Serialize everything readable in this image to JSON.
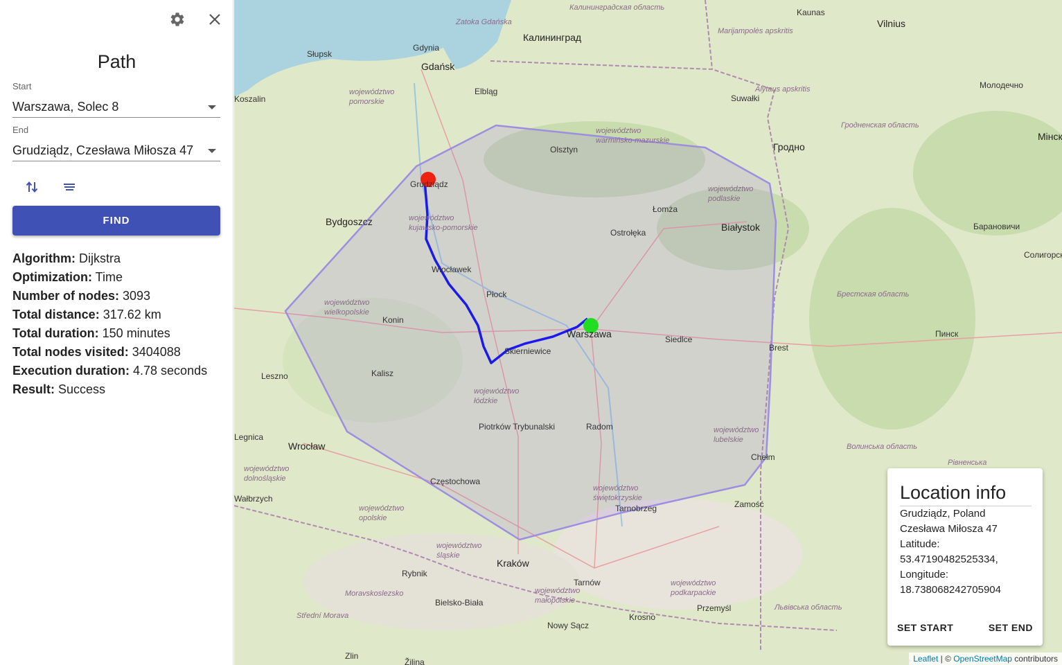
{
  "sidebar": {
    "title": "Path",
    "start_label": "Start",
    "start_value": "Warszawa,  Solec 8",
    "end_label": "End",
    "end_value": "Grudziądz,  Czesława Miłosza 47",
    "find_label": "FIND",
    "results": [
      {
        "label": "Algorithm:",
        "value": "Dijkstra"
      },
      {
        "label": "Optimization:",
        "value": "Time"
      },
      {
        "label": "Number of nodes:",
        "value": "3093"
      },
      {
        "label": "Total distance:",
        "value": "317.62 km"
      },
      {
        "label": "Total duration:",
        "value": "150 minutes"
      },
      {
        "label": "Total nodes visited:",
        "value": "3404088"
      },
      {
        "label": "Execution duration:",
        "value": "4.78 seconds"
      },
      {
        "label": "Result:",
        "value": "Success"
      }
    ]
  },
  "icons": {
    "settings": "gear-icon",
    "close": "close-icon",
    "swap": "swap-vertical-icon",
    "options": "sort-lines-icon"
  },
  "map": {
    "cities": [
      "Gdańsk",
      "Gdynia",
      "Słupsk",
      "Koszalin",
      "Elbląg",
      "Калининград",
      "Olsztyn",
      "Suwałki",
      "Kaunas",
      "Vilnius",
      "Гродно",
      "Białystok",
      "Łomża",
      "Ostrołęka",
      "Grudziądz",
      "Bydgoszcz",
      "Włocławek",
      "Płock",
      "Warszawa",
      "Konin",
      "Skierniewice",
      "Siedlce",
      "Brest",
      "Kalisz",
      "Leszno",
      "Piotrków Trybunalski",
      "Radom",
      "Chełm",
      "Wrocław",
      "Legnica",
      "Wałbrzych",
      "Częstochowa",
      "Tarnobrzeg",
      "Zamość",
      "Kraków",
      "Rybnik",
      "Tarnów",
      "Bielsko-Biała",
      "Nowy Sącz",
      "Krosno",
      "Przemyśl",
      "Zlin",
      "Žilina",
      "Молодечно",
      "Мінск",
      "Барановичи",
      "Солигорск",
      "Пинск",
      "Marijampolės apskritis",
      "Alytaus apskritis",
      "Zatoka Gdańska",
      "Калининградская область",
      "Гродненская область",
      "Брестская область",
      "Волинська область",
      "Рівненська",
      "Львівська область"
    ],
    "regions": [
      "województwo pomorskie",
      "województwo warmińsko-mazurskie",
      "województwo podlaskie",
      "województwo kujawsko-pomorskie",
      "województwo wielkopolskie",
      "województwo łódzkie",
      "województwo lubelskie",
      "województwo dolnośląskie",
      "województwo opolskie",
      "województwo śląskie",
      "województwo świętokrzyskie",
      "województwo małopolskie",
      "województwo podkarpackie",
      "Moravskoslezsko",
      "Střední Morava"
    ],
    "start_marker_color": "#22dd22",
    "end_marker_color": "#ee2211",
    "route_color": "#1a1aee",
    "area_color": "#9370db"
  },
  "location_info": {
    "title": "Location info",
    "line1": "Grudziądz, Poland",
    "line2": "Czesława Miłosza 47",
    "line3": "Latitude:",
    "line4": "53.47190482525334,",
    "line5": "Longitude:",
    "line6": "18.738068242705904",
    "set_start": "SET START",
    "set_end": "SET END"
  },
  "attribution": {
    "leaflet": "Leaflet",
    "sep": " | © ",
    "osm": "OpenStreetMap",
    "suffix": " contributors"
  }
}
